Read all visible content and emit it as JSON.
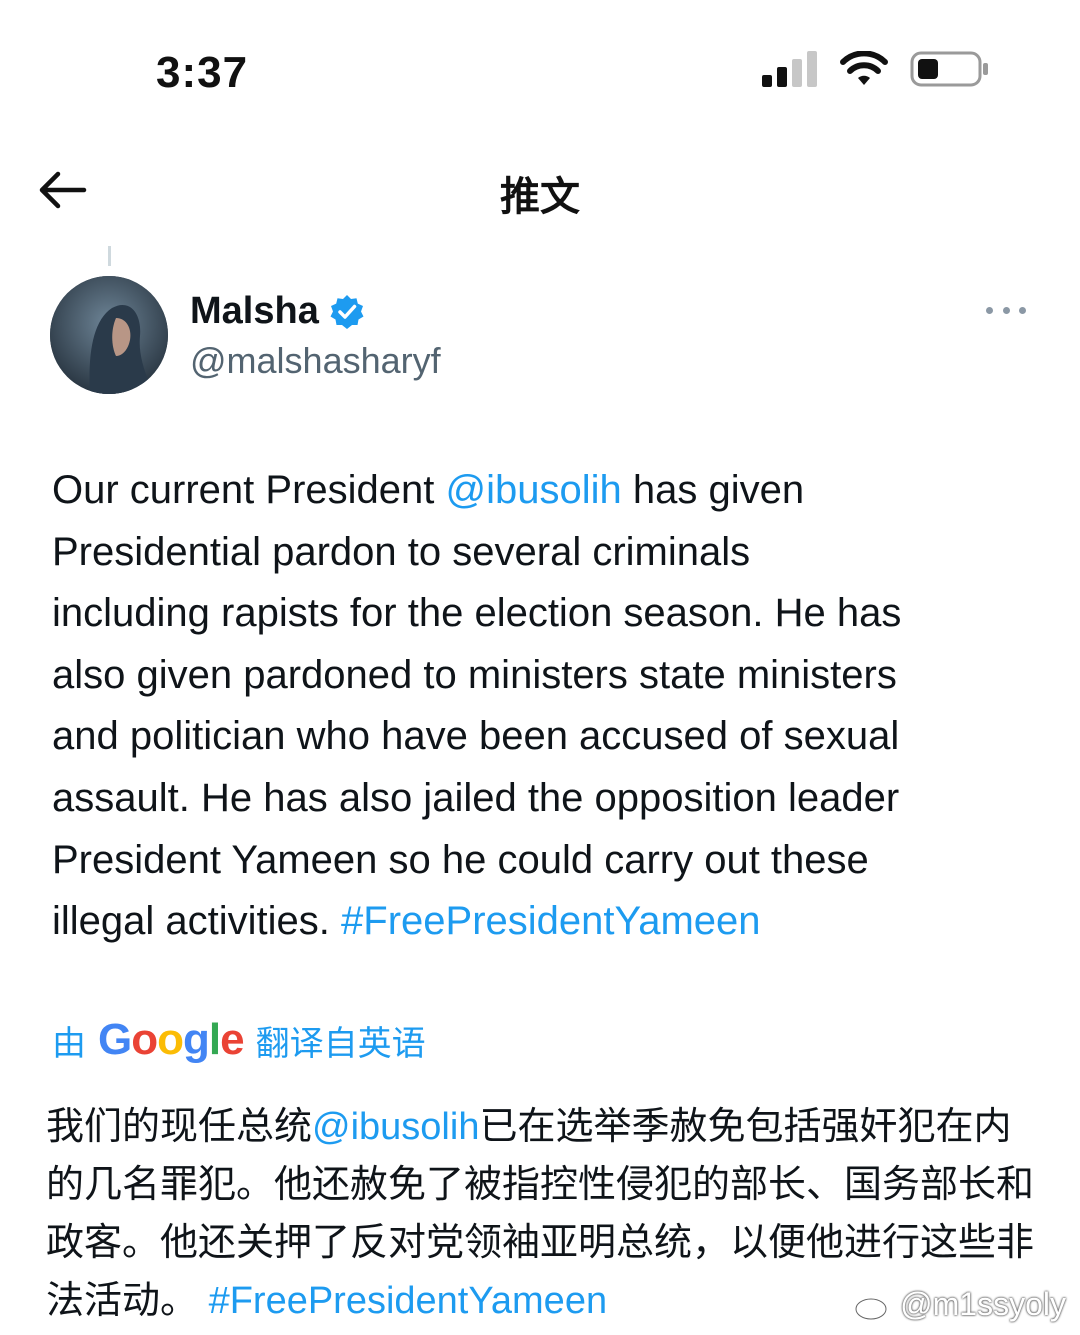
{
  "status_bar": {
    "time": "3:37"
  },
  "header": {
    "title": "推文"
  },
  "tweet": {
    "display_name": "Malsha",
    "handle": "@malshasharyf",
    "text_parts": {
      "p1": "Our current President ",
      "mention": "@ibusolih",
      "p2": " has given\nPresidential pardon to several criminals\nincluding rapists for the election season. He has\nalso given pardoned to ministers state ministers\nand politician who have been accused of sexual\nassault. He has also jailed the opposition leader\nPresident Yameen so he could carry out these\nillegal activities. ",
      "hashtag": "#FreePresidentYameen"
    }
  },
  "translation": {
    "prefix": "由",
    "provider_letters": [
      "G",
      "o",
      "o",
      "g",
      "l",
      "e"
    ],
    "suffix": "翻译自英语",
    "text_parts": {
      "p1": "我们的现任总统",
      "mention": "@ibusolih",
      "p2": "已在选举季赦免包括强奸犯在内的几名罪犯。他还赦免了被指控性侵犯的部长、国务部长和政客。他还关押了反对党领袖亚明总统，以便他进行这些非法活动。 ",
      "hashtag": "#FreePresidentYameen"
    }
  },
  "watermark": {
    "text": "@m1ssyoly"
  },
  "colors": {
    "link": "#1d9bf0",
    "verified": "#1d9bf0",
    "text": "#0f1419",
    "secondary": "#536471"
  },
  "icons": [
    "signal-icon",
    "wifi-icon",
    "battery-icon",
    "back-arrow-icon",
    "verified-badge-icon",
    "more-icon",
    "weibo-icon"
  ]
}
